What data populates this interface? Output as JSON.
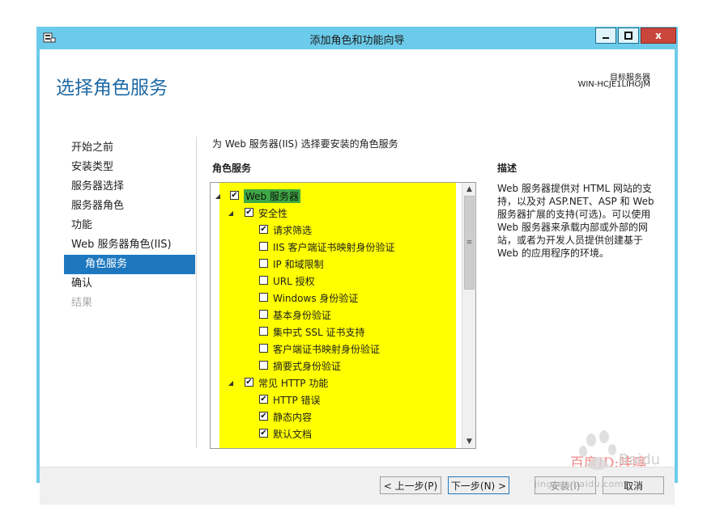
{
  "window": {
    "title": "添加角色和功能向导",
    "close_label": "x",
    "colors": {
      "frame": "#6ccbea",
      "accent": "#1e78bf",
      "highlight": "#ffff00"
    }
  },
  "header": {
    "page_title": "选择角色服务",
    "target_server_label": "目标服务器",
    "target_server_name": "WIN-HCJE1LIHOJM"
  },
  "nav": {
    "items": [
      {
        "label": "开始之前",
        "state": "normal"
      },
      {
        "label": "安装类型",
        "state": "normal"
      },
      {
        "label": "服务器选择",
        "state": "normal"
      },
      {
        "label": "服务器角色",
        "state": "normal"
      },
      {
        "label": "功能",
        "state": "normal"
      },
      {
        "label": "Web 服务器角色(IIS)",
        "state": "normal"
      },
      {
        "label": "角色服务",
        "state": "active"
      },
      {
        "label": "确认",
        "state": "normal"
      },
      {
        "label": "结果",
        "state": "disabled"
      }
    ]
  },
  "main": {
    "instruction": "为 Web 服务器(IIS) 选择要安装的角色服务",
    "role_services_header": "角色服务",
    "tree": [
      {
        "label": "Web 服务器",
        "checked": true,
        "expanded": true,
        "level": 0,
        "selected": true
      },
      {
        "label": "安全性",
        "checked": true,
        "expanded": true,
        "level": 1
      },
      {
        "label": "请求筛选",
        "checked": true,
        "level": 2
      },
      {
        "label": "IIS 客户端证书映射身份验证",
        "checked": false,
        "level": 2
      },
      {
        "label": "IP 和域限制",
        "checked": false,
        "level": 2
      },
      {
        "label": "URL 授权",
        "checked": false,
        "level": 2
      },
      {
        "label": "Windows 身份验证",
        "checked": false,
        "level": 2
      },
      {
        "label": "基本身份验证",
        "checked": false,
        "level": 2
      },
      {
        "label": "集中式 SSL 证书支持",
        "checked": false,
        "level": 2
      },
      {
        "label": "客户端证书映射身份验证",
        "checked": false,
        "level": 2
      },
      {
        "label": "摘要式身份验证",
        "checked": false,
        "level": 2
      },
      {
        "label": "常见 HTTP 功能",
        "checked": true,
        "expanded": true,
        "level": 1
      },
      {
        "label": "HTTP 错误",
        "checked": true,
        "level": 2
      },
      {
        "label": "静态内容",
        "checked": true,
        "level": 2
      },
      {
        "label": "默认文档",
        "checked": true,
        "level": 2
      }
    ]
  },
  "description": {
    "title": "描述",
    "text": "Web 服务器提供对 HTML 网站的支持，以及对 ASP.NET、ASP 和 Web 服务器扩展的支持(可选)。可以使用 Web 服务器来承载内部或外部的网站，或者为开发人员提供创建基于 Web 的应用程序的环境。"
  },
  "footer": {
    "prev_label": "< 上一步(P)",
    "next_label": "下一步(N) >",
    "install_label": "安装(I)",
    "cancel_label": "取消"
  },
  "watermark": {
    "text": "百度ID:哇噻",
    "site": "jingyan.baidu.com",
    "logo_text": "Baidu 经验"
  }
}
